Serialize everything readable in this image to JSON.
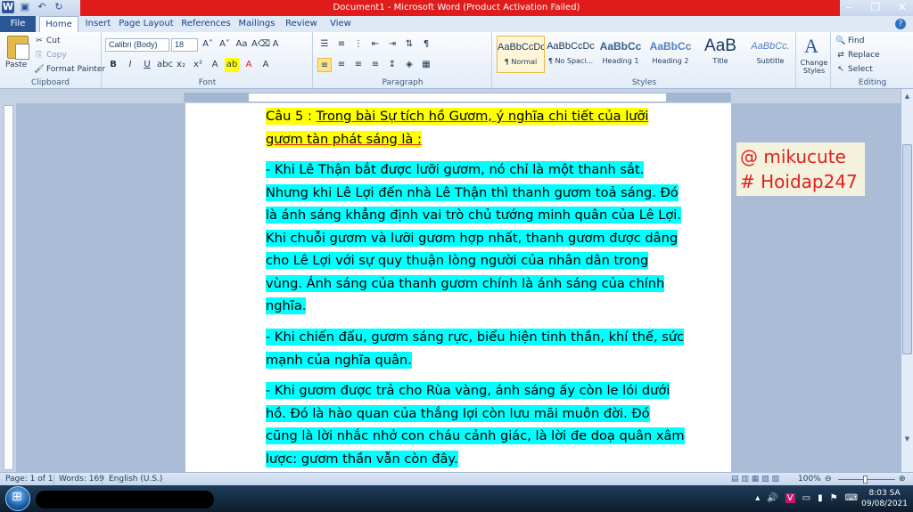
{
  "window": {
    "title": "Document1 - Microsoft Word (Product Activation Failed)"
  },
  "tabs": [
    "File",
    "Home",
    "Insert",
    "Page Layout",
    "References",
    "Mailings",
    "Review",
    "View"
  ],
  "clipboard": {
    "paste": "Paste",
    "cut": "Cut",
    "copy": "Copy",
    "format_painter": "Format Painter",
    "label": "Clipboard"
  },
  "font": {
    "name": "Calibri (Body)",
    "size": "18",
    "label": "Font"
  },
  "paragraph": {
    "label": "Paragraph"
  },
  "styles": {
    "label": "Styles",
    "items": [
      {
        "preview": "AaBbCcDc",
        "name": "¶ Normal"
      },
      {
        "preview": "AaBbCcDc",
        "name": "¶ No Spaci..."
      },
      {
        "preview": "AaBbCc",
        "name": "Heading 1"
      },
      {
        "preview": "AaBbCc",
        "name": "Heading 2"
      },
      {
        "preview": "AaB",
        "name": "Title"
      },
      {
        "preview": "AaBbCc.",
        "name": "Subtitle"
      }
    ],
    "change_styles": "Change Styles"
  },
  "editing": {
    "label": "Editing",
    "find": "Find",
    "replace": "Replace",
    "select": "Select"
  },
  "document": {
    "question": {
      "prefix": "Câu 5 : ",
      "text": "Trong bài Sự tích hồ Gươm, ý nghĩa chi tiết của lưỡi gươm tàn phát sáng là :"
    },
    "paragraphs": [
      "- Khi Lê Thận bắt được lưỡi gươm, nó chỉ là một thanh sắt. Nhưng khi Lê Lợi đến nhà Lê Thận thì thanh gươm toả sáng. Đó là ánh sáng khẳng định vai trò chủ tướng minh quân của Lê Lợi. Khi chuỗi gươm và lưỡi gươm hợp nhất, thanh gươm được dâng cho Lê Lợi với sự quy thuận lòng người của nhân dân trong vùng. Ánh sáng của thanh gươm chính là ánh sáng của chính nghĩa.",
      "- Khi chiến đấu, gươm sáng rực, biểu hiện tinh thần, khí thế, sức mạnh của nghĩa quân.",
      "- Khi gươm được trả cho Rùa vàng, ánh sáng ấy còn le lói dưới hồ. Đó là hào quan của thắng lợi còn lưu mãi muôn đời. Đó cũng là lời nhắc nhở con cháu cảnh giác, là lời đe doạ quân xâm lược: gươm thần vẫn còn đây."
    ]
  },
  "watermark": {
    "line1": "@ mikucute",
    "line2": "# Hoidap247"
  },
  "statusbar": {
    "page": "Page: 1 of 1",
    "words": "Words: 169",
    "language": "English (U.S.)",
    "zoom": "100%"
  },
  "taskbar": {
    "time": "8:03 SA",
    "date": "09/08/2021"
  },
  "colors": {
    "title_bar_red": "#e01b1b",
    "highlight_yellow": "#ffff00",
    "highlight_cyan": "#00ffff",
    "watermark_text": "#e02020"
  }
}
